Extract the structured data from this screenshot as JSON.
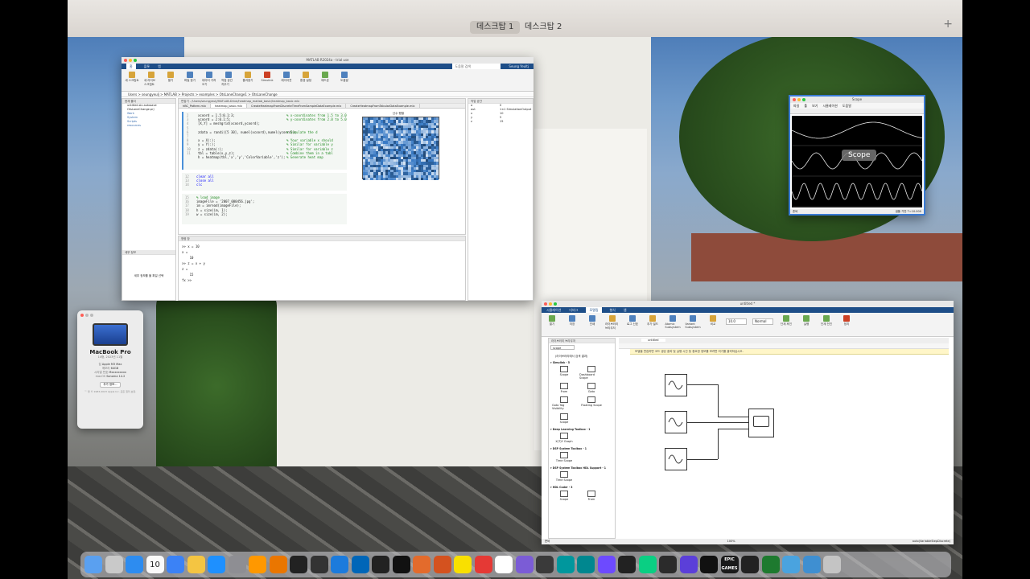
{
  "desktop": {
    "spaces": [
      "데스크탑 1",
      "데스크탑 2"
    ],
    "active_space": 0,
    "add_label": "+"
  },
  "matlab": {
    "title": "MATLAB R2024a - trial use",
    "ribbon_tabs": [
      "홈",
      "플롯",
      "앱"
    ],
    "ribbon_buttons": [
      "새 스크립트",
      "새 라이브 스크립트",
      "열기",
      "파일 찾기",
      "데이터 가져오기",
      "작업 공간 지우기",
      "즐겨찾기",
      "Simulink",
      "레이아웃",
      "환경 설정",
      "애드온",
      "도움말"
    ],
    "search_placeholder": "도움말 검색",
    "user": "Seung Yeultj",
    "path": "Users > seungyeulj > MATLAB > Projects > examples > OtsLaneChange1 > OtsLaneChange",
    "current_folder_title": "현재 폴더",
    "files": [
      "untitled.slx.autosave",
      "OtsLaneChange.prj",
      "Work",
      "System",
      "Scripts",
      "resources"
    ],
    "details_label": "세부 정보",
    "details_hint": "세부 정보를 볼 파일 선택",
    "editor_path": "편집기 - /Users/seungyeulj/MATLAB-Drive/heatmap_matlab_basic/heatmap_basic.mlx",
    "editor_tabs": [
      "hBC_Pattern.mlx",
      "heatmap_basic.mlx",
      "CreateHeatmapFromDiscreteTimeFromSampleDataExample.mlx",
      "CreateHeatmapFromTabularDataExample.mlx"
    ],
    "code_lines": [
      {
        "n": "2",
        "code": "xcoord = 1.5:0.1:3;",
        "cmt": "% x-coordinates from 1.5 to 3.0"
      },
      {
        "n": "3",
        "code": "ycoord = 2:0.1:5;",
        "cmt": "% y-coordinates from 2.0 to 5.0"
      },
      {
        "n": "4",
        "code": "[X,Y] = meshgrid(xcoord,ycoord);",
        "cmt": ""
      },
      {
        "n": "5",
        "code": "",
        "cmt": ""
      },
      {
        "n": "6",
        "code": "zdata = randi([5 30], numel(xcoord),numel(ycoord));",
        "cmt": "% Simulate the d"
      },
      {
        "n": "7",
        "code": "",
        "cmt": ""
      },
      {
        "n": "8",
        "code": "x = X(:);",
        "cmt": "% Your variable x should"
      },
      {
        "n": "9",
        "code": "y = Y(:);",
        "cmt": "% Similar for variable y"
      },
      {
        "n": "10",
        "code": "z = zdata(:);",
        "cmt": "% Similar for variable z"
      },
      {
        "n": "11",
        "code": "tbl = table(x,y,z);",
        "cmt": "% Combine them in a tabl"
      },
      {
        "n": "",
        "code": "h = heatmap(tbl,'x','y','ColorVariable','z');",
        "cmt": "% Generate heat map"
      }
    ],
    "code_lines2": [
      "clear all",
      "close all",
      "clc"
    ],
    "code_lines2_nums": [
      "12",
      "13",
      "14"
    ],
    "code_lines3": [
      "% load image",
      "imageFile = '2007_000456.jpg';",
      "im = imread(imageFile);",
      "h = size(im, 1);",
      "w = size(im, 2);"
    ],
    "code_lines3_nums": [
      "15",
      "16",
      "17",
      "18",
      "19"
    ],
    "heatmap_title": "난수 행렬",
    "command_title": "명령 창",
    "command_lines": [
      ">> x = 10",
      "x =",
      "    10",
      ">> z = x + y",
      "z =",
      "    15",
      "fx >>"
    ],
    "workspace_title": "작업 공간",
    "workspace_vars": [
      {
        "name": "a",
        "value": "0"
      },
      {
        "name": "out",
        "value": "1×1 SimulationOutput"
      },
      {
        "name": "x",
        "value": "10"
      },
      {
        "name": "y",
        "value": "5"
      },
      {
        "name": "z",
        "value": "15"
      }
    ]
  },
  "scope": {
    "title": "Scope",
    "menus": [
      "파일",
      "툴",
      "보기",
      "시뮬레이션",
      "도움말"
    ],
    "overlay_label": "Scope",
    "status_left": "준비",
    "status_right": "샘플 기반  T=10.000"
  },
  "about": {
    "model": "MacBook Pro",
    "subtitle": "14형, 2023년 11월",
    "specs": [
      {
        "k": "칩",
        "v": "Apple M3 Max"
      },
      {
        "k": "메모리",
        "v": "64GB"
      },
      {
        "k": "시리얼 번호",
        "v": "Mxxxxxxxxx"
      },
      {
        "k": "macOS",
        "v": "Sonoma 14.2"
      }
    ],
    "more_button": "추가 정보...",
    "copyright": "™ 및 © 1983-2023 Apple Inc. 모든 권리 보유."
  },
  "simulink": {
    "title": "untitled *",
    "ribbon_tabs": [
      "시뮬레이션",
      "디버그",
      "모델링",
      "형식",
      "앱"
    ],
    "ribbon_buttons": [
      "열기",
      "저장",
      "인쇄",
      "라이브러리 브라우저",
      "로그 신호",
      "추가 빌드",
      "Atomic Subsystem",
      "Variant Subsystem",
      "비교",
      "실행",
      "단계 후진",
      "단계 전진",
      "정지"
    ],
    "stop_time": "10.0",
    "mode": "Normal",
    "library_title": "라이브러리 브라우저",
    "library_search": "scope",
    "library_results": "(라이브러리에서 검색 결과)",
    "lib_groups": [
      {
        "title": "Simulink - 5",
        "items": [
          "Scope",
          "Dashboard Scope",
          "From",
          "Goto",
          "Goto Tag Visibility",
          "Floating Scope",
          "Scope"
        ]
      },
      {
        "title": "Deep Learning Toolbox - 1",
        "items": [
          "X(T)Y Graph"
        ]
      },
      {
        "title": "DSP System Toolbox - 1",
        "items": [
          "Time Scope"
        ]
      },
      {
        "title": "DSP System Toolbox HDL Support - 1",
        "items": [
          "Time Scope"
        ]
      },
      {
        "title": "HDL Coder - 3",
        "items": [
          "Scope",
          "From"
        ]
      }
    ],
    "model_tab": "untitled",
    "banner": "모델을 편집하면 코드 생성 결과 및 실행 시간 등 중요한 정보를 보려면 여기를 클릭하십시오.",
    "status_left": "준비",
    "zoom": "100%",
    "solver": "auto(VariableStepDiscrete)"
  },
  "colors": {
    "matlab_blue": "#1e4e88",
    "sine_block": "#ffffff",
    "scope_wave": "#e8e8e8"
  },
  "dock_icons": [
    "finder-icon",
    "launchpad-icon",
    "safari-icon",
    "calendar-icon",
    "mail-icon",
    "photos-icon",
    "appstore-icon",
    "settings-icon",
    "sublime-icon",
    "blender-icon",
    "inkscape-icon",
    "zbrush-icon",
    "xcode-icon",
    "vscode-icon",
    "unity-icon",
    "unreal-icon",
    "matlab-icon",
    "matlab2-icon",
    "kakaotalk-icon",
    "youtube-icon",
    "chrome-icon",
    "photomator-icon",
    "pixelmator-icon",
    "arduino-icon",
    "arduino2-icon",
    "vectorworks-icon",
    "finalcut-icon",
    "figma-icon",
    "mindnode-icon",
    "vectorworks2-icon",
    "nvidia-icon",
    "epicgames-icon",
    "terminal-icon",
    "activity-icon",
    "folder-icon",
    "folder2-icon",
    "trash-icon"
  ],
  "dock_calendar_day": "10",
  "dock_epic_label": "EPIC GAMES"
}
